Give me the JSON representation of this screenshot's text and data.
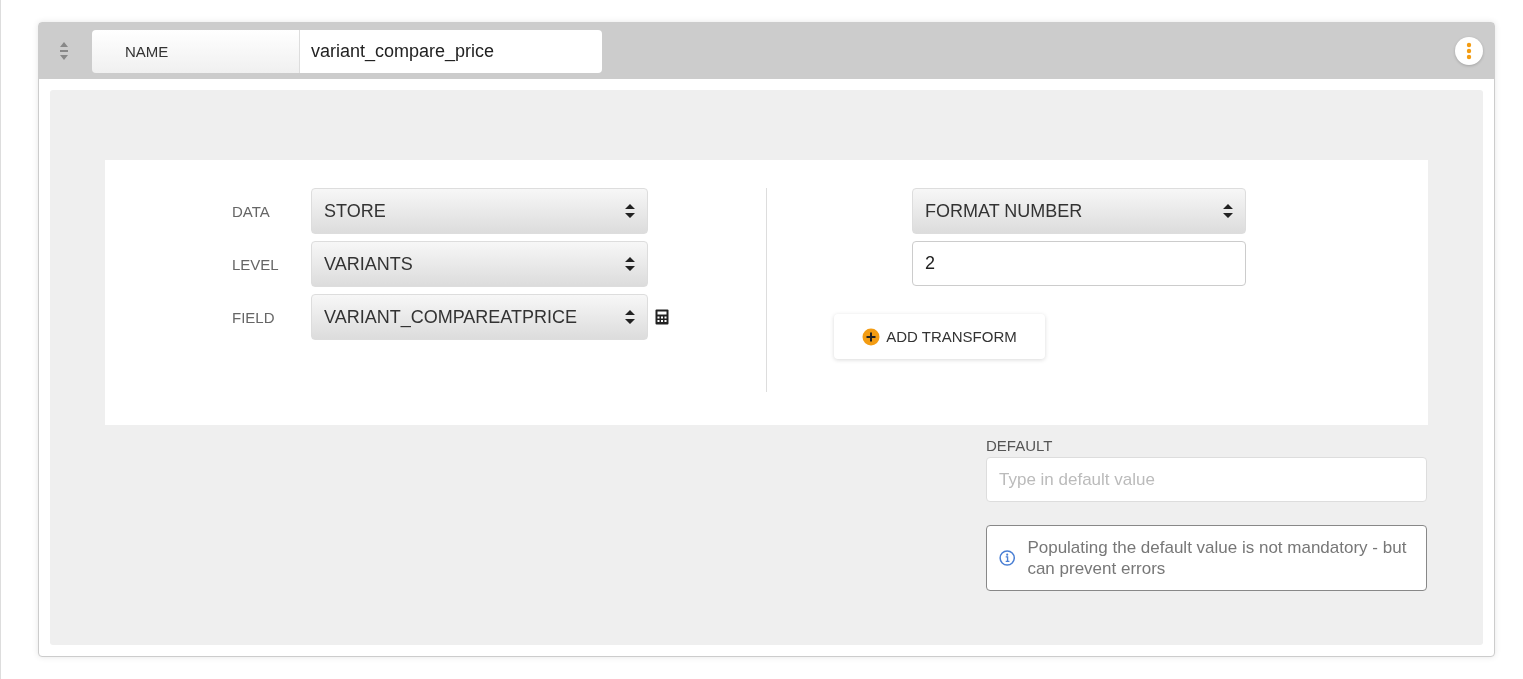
{
  "header": {
    "name_label": "NAME",
    "name_value": "variant_compare_price"
  },
  "source": [
    {
      "label": "DATA",
      "value": "STORE",
      "calculator": false
    },
    {
      "label": "LEVEL",
      "value": "VARIANTS",
      "calculator": false
    },
    {
      "label": "FIELD",
      "value": "VARIANT_COMPAREATPRICE",
      "calculator": true
    }
  ],
  "transform": {
    "select": "FORMAT NUMBER",
    "value": "2",
    "add_button": "ADD TRANSFORM"
  },
  "default": {
    "label": "DEFAULT",
    "placeholder": "Type in default value",
    "info": "Populating the default value is not mandatory - but can prevent errors"
  }
}
